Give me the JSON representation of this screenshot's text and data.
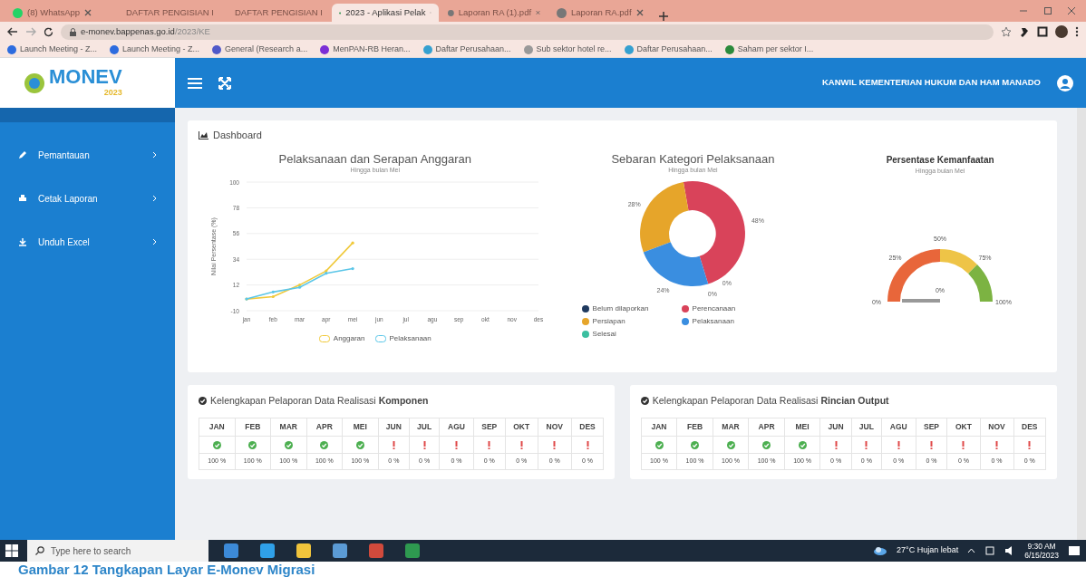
{
  "browser": {
    "tabs": [
      {
        "title": "(8) WhatsApp",
        "kind": "chat",
        "selected": false
      },
      {
        "title": "DAFTAR PENGISIAN I",
        "kind": "doc",
        "selected": false
      },
      {
        "title": "DAFTAR PENGISIAN I",
        "kind": "doc",
        "selected": false
      },
      {
        "title": "2023 - Aplikasi Pelak",
        "kind": "globe",
        "selected": true
      },
      {
        "title": "Laporan RA (1).pdf",
        "kind": "pdf",
        "selected": false
      },
      {
        "title": "Laporan RA.pdf",
        "kind": "pdf",
        "selected": false
      }
    ],
    "address": {
      "host": "e-monev.bappenas.go.id",
      "path": "/2023/KE"
    },
    "bookmarks": [
      "Launch Meeting - Z...",
      "Launch Meeting - Z...",
      "General (Research a...",
      "MenPAN-RB Heran...",
      "Daftar Perusahaan...",
      "Sub sektor hotel re...",
      "Daftar Perusahaan...",
      "Saham per sektor I..."
    ]
  },
  "app": {
    "logo": {
      "name": "MONEV",
      "year": "2023"
    },
    "office": "KANWIL KEMENTERIAN HUKUM DAN HAM MANADO",
    "sidebar": {
      "items": [
        {
          "label": "Pemantauan",
          "kind": "pencil"
        },
        {
          "label": "Cetak Laporan",
          "kind": "print"
        },
        {
          "label": "Unduh Excel",
          "kind": "download"
        }
      ]
    },
    "page_title": "Dashboard",
    "line_panel": {
      "title": "Pelaksanaan dan Serapan Anggaran",
      "subtitle": "Hingga bulan Mei",
      "chart_data": {
        "type": "line",
        "grid": true,
        "ylabel": "Nilai Persentase (%)",
        "categories": [
          "jan",
          "feb",
          "mar",
          "apr",
          "mei",
          "jun",
          "jul",
          "agu",
          "sep",
          "okt",
          "nov",
          "des"
        ],
        "yticks": [
          -10,
          12,
          34,
          56,
          78,
          100
        ],
        "ylim": [
          -10,
          100
        ],
        "series": [
          {
            "name": "Anggaran",
            "color": "#f0c93a",
            "values": [
              0,
              2,
              12,
              24,
              48,
              null,
              null,
              null,
              null,
              null,
              null,
              null
            ]
          },
          {
            "name": "Pelaksanaan",
            "color": "#5bc6e8",
            "values": [
              0,
              6,
              10,
              22,
              26,
              null,
              null,
              null,
              null,
              null,
              null,
              null
            ]
          }
        ]
      }
    },
    "donut_panel": {
      "title": "Sebaran Kategori Pelaksanaan",
      "subtitle": "Hingga bulan Mei",
      "chart_data": {
        "type": "donut",
        "categories": [
          "Belum dilaporkan",
          "Perencanaan",
          "Persiapan",
          "Pelaksanaan",
          "Selesai"
        ],
        "series": [
          {
            "colors": [
              "#1f3a5f",
              "#d9435a",
              "#e6a52a",
              "#3a8ee0",
              "#3bbfa0"
            ],
            "values": [
              0,
              48,
              28,
              24,
              0
            ]
          }
        ],
        "value_labels": [
          "0%",
          "48%",
          "28%",
          "24%",
          "0%"
        ]
      }
    },
    "gauge_panel": {
      "title": "Persentase Kemanfaatan",
      "subtitle": "Hingga bulan Mei",
      "tick_labels": [
        "0%",
        "25%",
        "50%",
        "75%",
        "100%"
      ],
      "reading": "0%"
    },
    "tables": [
      {
        "title": "Kelengkapan Pelaporan Data Realisasi **Komponen**",
        "columns": [
          "JAN",
          "FEB",
          "MAR",
          "APR",
          "MEI",
          "JUN",
          "JUL",
          "AGU",
          "SEP",
          "OKT",
          "NOV",
          "DES"
        ],
        "complete": [
          true,
          true,
          true,
          true,
          true,
          false,
          false,
          false,
          false,
          false,
          false,
          false
        ],
        "percent": [
          "100 %",
          "100 %",
          "100 %",
          "100 %",
          "100 %",
          "0 %",
          "0 %",
          "0 %",
          "0 %",
          "0 %",
          "0 %",
          "0 %"
        ]
      },
      {
        "title": "Kelengkapan Pelaporan Data Realisasi **Rincian Output**",
        "columns": [
          "JAN",
          "FEB",
          "MAR",
          "APR",
          "MEI",
          "JUN",
          "JUL",
          "AGU",
          "SEP",
          "OKT",
          "NOV",
          "DES"
        ],
        "complete": [
          true,
          true,
          true,
          true,
          true,
          false,
          false,
          false,
          false,
          false,
          false,
          false
        ],
        "percent": [
          "100 %",
          "100 %",
          "100 %",
          "100 %",
          "100 %",
          "0 %",
          "0 %",
          "0 %",
          "0 %",
          "0 %",
          "0 %",
          "0 %"
        ]
      }
    ]
  },
  "taskbar": {
    "search_placeholder": "Type here to search",
    "weather": "27°C  Hujan lebat",
    "time": "9:30 AM",
    "date": "6/15/2023"
  },
  "caption": "Gambar 12 Tangkapan Layar E-Monev Migrasi"
}
